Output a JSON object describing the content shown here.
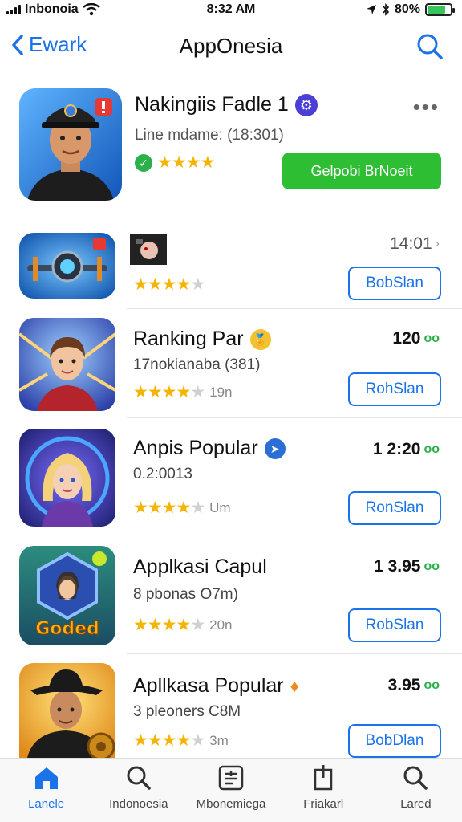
{
  "status_bar": {
    "carrier": "Inbonoia",
    "time": "8:32 AM",
    "battery": "80%",
    "battery_level": 0.8
  },
  "nav": {
    "back_label": "Ewark",
    "title": "AppOnesia"
  },
  "featured": {
    "title": "Nakingiis Fadle 1",
    "subtitle": "Line mdame: (18:301)",
    "rating": 4,
    "button_label": "Gelpobi BrNoeit"
  },
  "apps": [
    {
      "title": "",
      "subtitle": "",
      "rating": 4,
      "rating_extra": "",
      "price": "14:01",
      "button_label": "BobSlan"
    },
    {
      "title": "Ranking Par",
      "subtitle": "17nokianaba (381)",
      "rating": 4,
      "rating_extra": "19n",
      "price": "120",
      "button_label": "RohSlan"
    },
    {
      "title": "Anpis Popular",
      "subtitle": "0.2:0013",
      "rating": 4,
      "rating_extra": "Um",
      "price": "1 2:20",
      "button_label": "RonSlan"
    },
    {
      "title": "Applkasi Capul",
      "subtitle": "8 pbonas O7m)",
      "rating": 4,
      "rating_extra": "20n",
      "price": "1 3.95",
      "button_label": "RobSlan"
    },
    {
      "title": "Apllkasa Popular",
      "subtitle": "3 pleoners C8M",
      "rating": 4,
      "rating_extra": "3m",
      "price": "3.95",
      "button_label": "BobDlan"
    }
  ],
  "app_icon_texts": {
    "goded": "Goded"
  },
  "tabs": [
    {
      "label": "Lanele",
      "icon": "home-icon"
    },
    {
      "label": "Indonoesia",
      "icon": "search-icon"
    },
    {
      "label": "Mbonemiega",
      "icon": "list-icon"
    },
    {
      "label": "Friakarl",
      "icon": "bookmark-icon"
    },
    {
      "label": "Lared",
      "icon": "search-icon"
    }
  ],
  "colors": {
    "accent": "#1a73e8",
    "get_button": "#2dbe33",
    "star": "#f5b400"
  }
}
